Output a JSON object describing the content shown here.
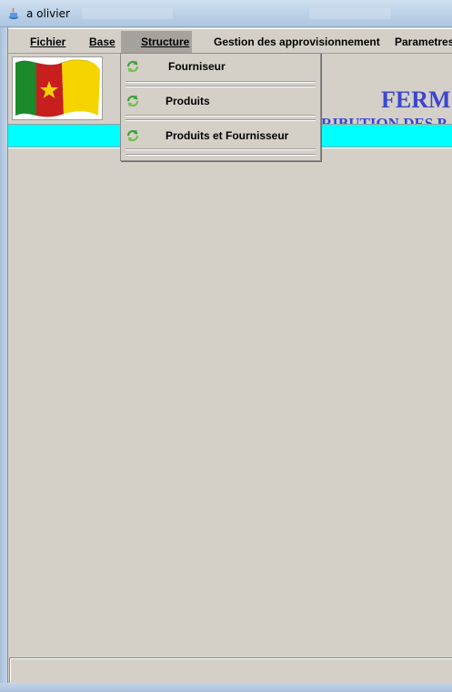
{
  "window": {
    "title": "a olivier",
    "icon": "java-cup-icon"
  },
  "menubar": {
    "items": [
      {
        "label": "Fichier"
      },
      {
        "label": "Base"
      },
      {
        "label": "Structure"
      },
      {
        "label": "Gestion des approvisionnement"
      },
      {
        "label": "Parametres"
      }
    ]
  },
  "banner": {
    "flag": "cameroon-flag",
    "title": "FERM",
    "subtitle": "RIBUTION DES P"
  },
  "dropdown": {
    "items": [
      {
        "label": "Fourniseur",
        "icon": "refresh-icon"
      },
      {
        "label": "Produits",
        "icon": "refresh-icon"
      },
      {
        "label": "Produits et Fournisseur",
        "icon": "refresh-icon"
      }
    ]
  },
  "colors": {
    "accent_cyan": "#00ffff",
    "banner_text": "#3b46d0",
    "flag_green": "#1a8a2a",
    "flag_red": "#c81e1e",
    "flag_yellow": "#f5d400"
  }
}
